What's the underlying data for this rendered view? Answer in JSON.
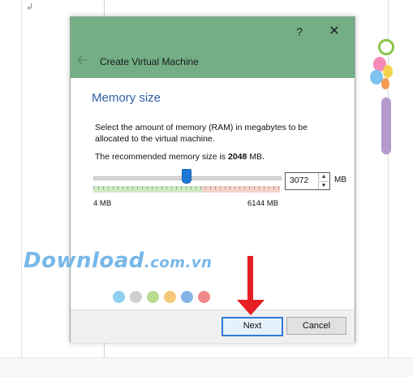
{
  "background": {
    "corner_glyph": "↲"
  },
  "dialog": {
    "title_bar": {
      "help_label": "?",
      "close_label": "✕",
      "back_icon": "left-arrow-icon",
      "wizard_title": "Create Virtual Machine",
      "color": "#73ae85"
    },
    "heading": "Memory size",
    "description": "Select the amount of memory (RAM) in megabytes to be allocated to the virtual machine.",
    "recommend_prefix": "The recommended memory size is ",
    "recommend_value": "2048",
    "recommend_suffix": " MB.",
    "slider": {
      "min_label": "4 MB",
      "max_label": "6144 MB",
      "min_mb": 4,
      "max_mb": 6144,
      "value_mb": 3072
    },
    "spinbox": {
      "value": "3072",
      "unit": "MB"
    },
    "buttons": {
      "next": "Next",
      "cancel": "Cancel"
    }
  },
  "watermark": {
    "text": "Download",
    "suffix": ".com.vn",
    "dot_colors": [
      "#8fd0f2",
      "#d0d0d0",
      "#b8dd92",
      "#f5c97a",
      "#84b5e3",
      "#f08a8a"
    ]
  },
  "annotation": {
    "arrow_color": "#e51f24"
  }
}
